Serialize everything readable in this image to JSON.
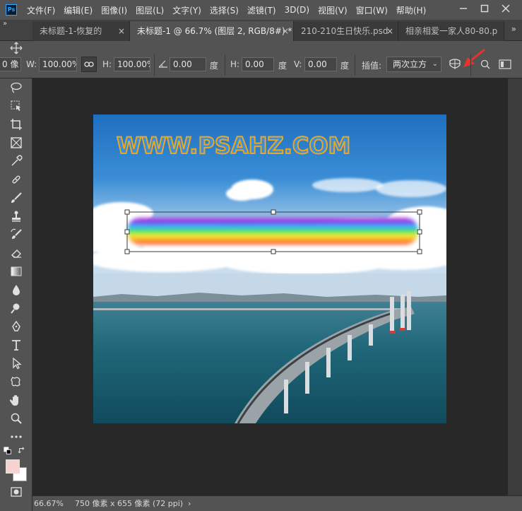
{
  "app": {
    "logo": "Ps"
  },
  "menu": [
    "文件(F)",
    "编辑(E)",
    "图像(I)",
    "图层(L)",
    "文字(Y)",
    "选择(S)",
    "滤镜(T)",
    "3D(D)",
    "视图(V)",
    "窗口(W)",
    "帮助(H)"
  ],
  "tabs": [
    {
      "title": "未标题-1-恢复的",
      "active": false
    },
    {
      "title": "未标题-1 @ 66.7% (图层 2, RGB/8#) *",
      "active": true
    },
    {
      "title": "210-210生日快乐.psd",
      "active": false
    },
    {
      "title": "相亲相爱一家人80-80.p",
      "active": false
    }
  ],
  "options": {
    "x_partial": "0 像",
    "w_label": "W:",
    "w_value": "100.00%",
    "h_label": "H:",
    "h_value": "100.00%",
    "angle_value": "0.00",
    "angle_unit": "度",
    "hskew_label": "H:",
    "hskew_value": "0.00",
    "hskew_unit": "度",
    "vskew_label": "V:",
    "vskew_value": "0.00",
    "vskew_unit": "度",
    "interp_label": "插值:",
    "interp_value": "两次立方"
  },
  "canvas": {
    "watermark": "WWW.PSAHZ.COM"
  },
  "status": {
    "zoom": "66.67%",
    "doc_info": "750 像素 x 655 像素 (72 ppi)",
    "arrow": "›"
  },
  "colors": {
    "foreground": "#f6d2d0",
    "background": "#ffffff",
    "accent": "#31a8ff",
    "annotation_arrow": "#e8322c"
  }
}
